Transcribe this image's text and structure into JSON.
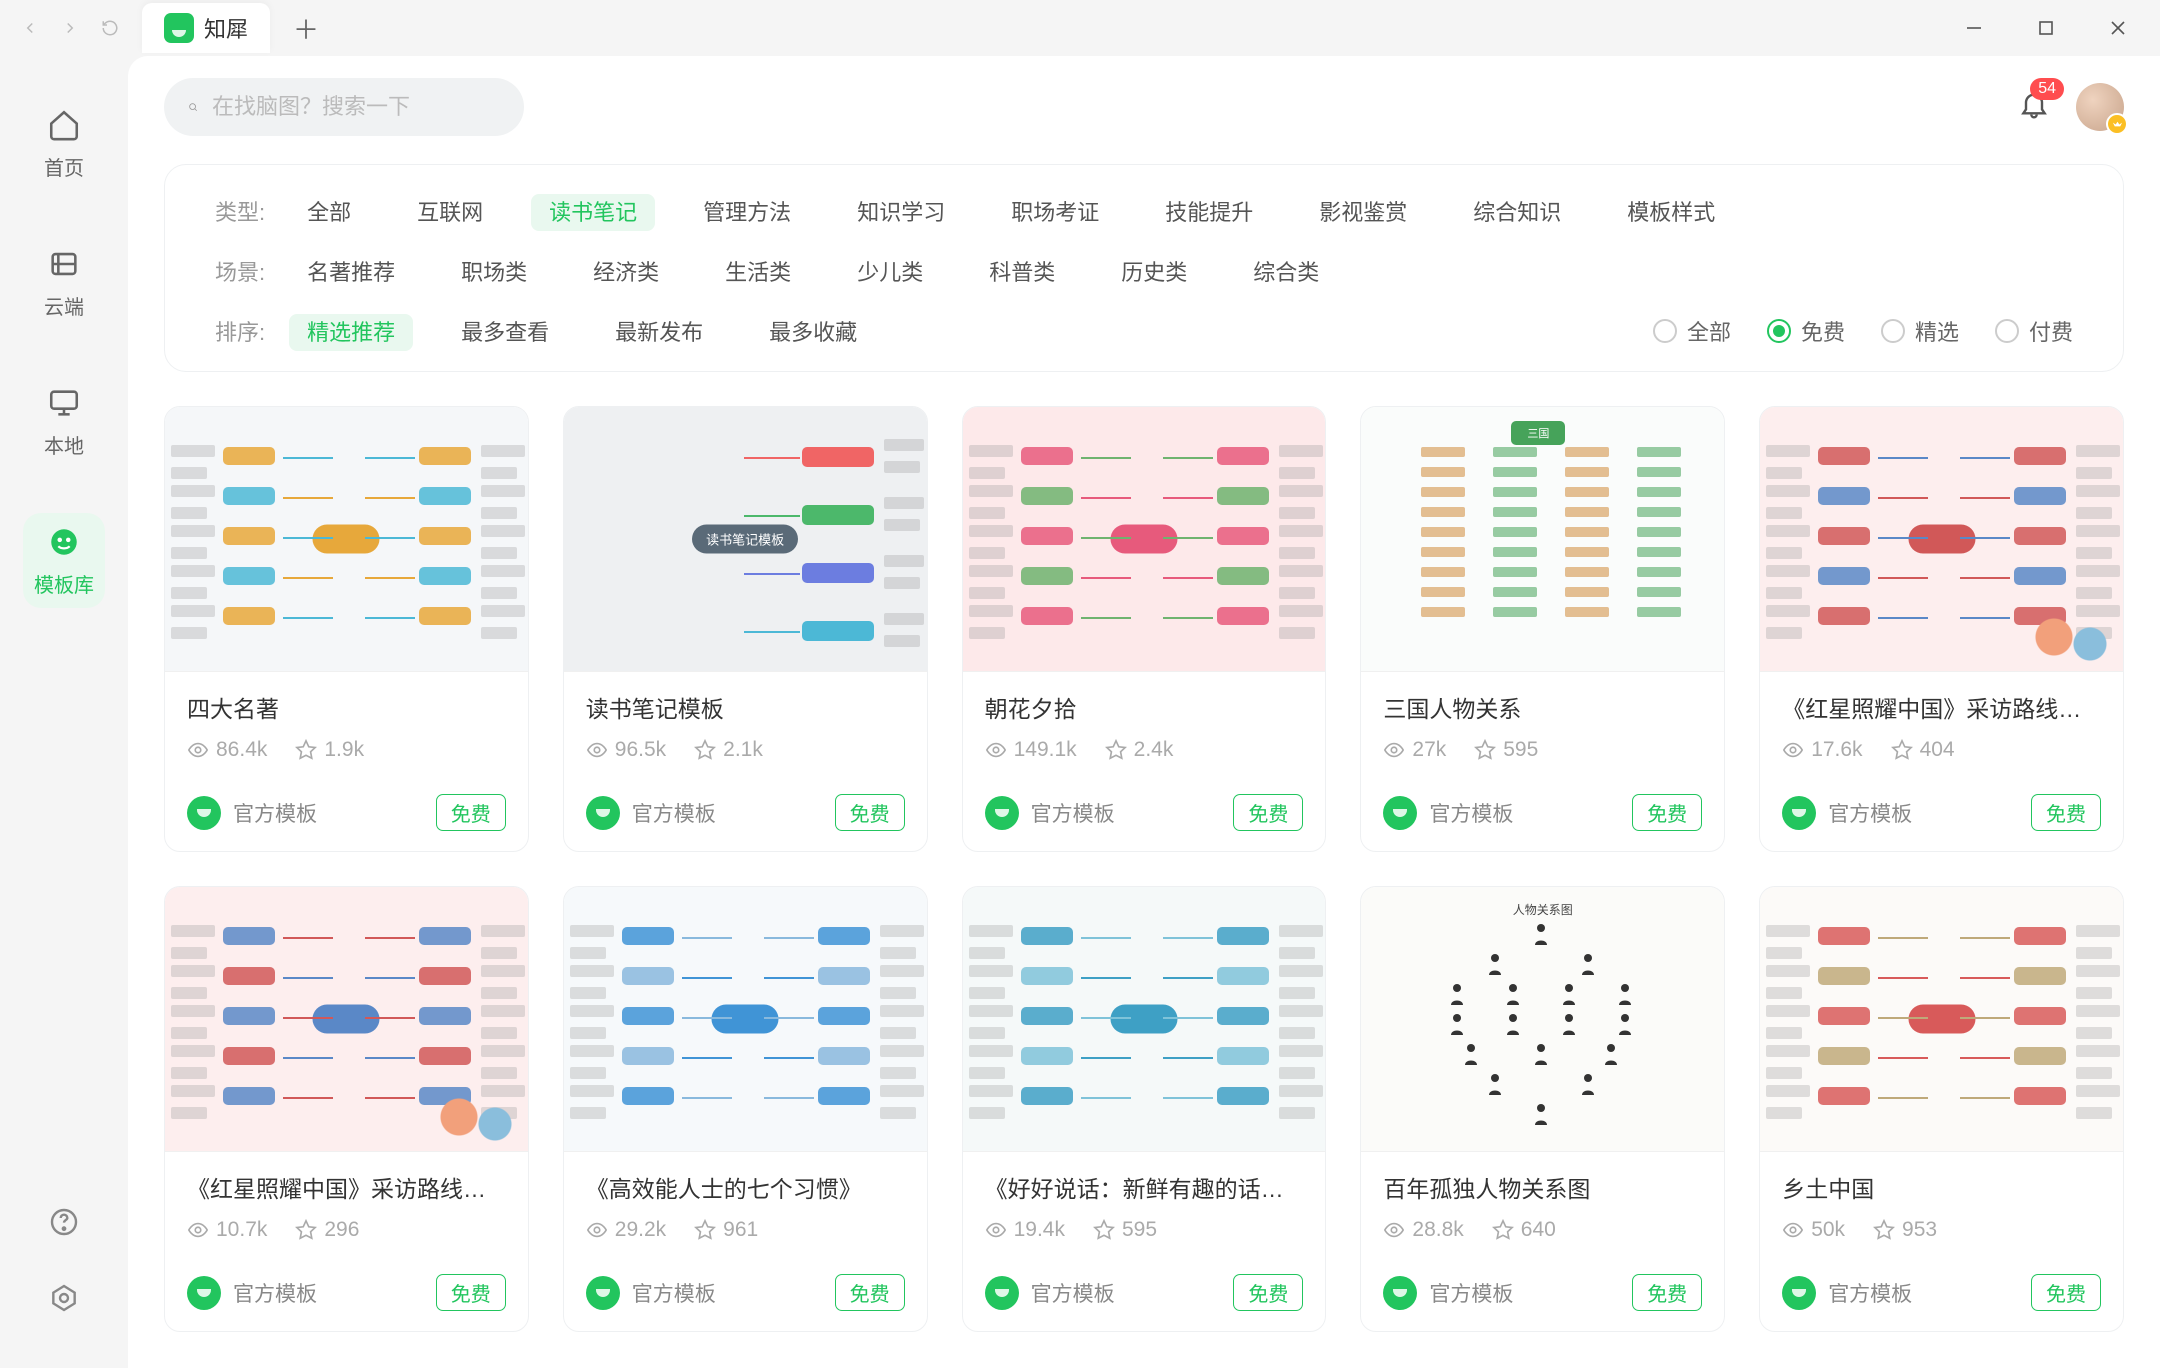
{
  "app": {
    "tab_title": "知犀"
  },
  "sidebar": {
    "items": [
      {
        "label": "首页"
      },
      {
        "label": "云端"
      },
      {
        "label": "本地"
      },
      {
        "label": "模板库"
      }
    ]
  },
  "search": {
    "placeholder": "在找脑图？搜索一下"
  },
  "notifications": {
    "count": "54"
  },
  "filters": {
    "type_label": "类型:",
    "types": [
      "全部",
      "互联网",
      "读书笔记",
      "管理方法",
      "知识学习",
      "职场考证",
      "技能提升",
      "影视鉴赏",
      "综合知识",
      "模板样式"
    ],
    "type_active_index": 2,
    "scene_label": "场景:",
    "scenes": [
      "名著推荐",
      "职场类",
      "经济类",
      "生活类",
      "少儿类",
      "科普类",
      "历史类",
      "综合类"
    ],
    "sort_label": "排序:",
    "sorts": [
      "精选推荐",
      "最多查看",
      "最新发布",
      "最多收藏"
    ],
    "sort_active_index": 0,
    "price": [
      "全部",
      "免费",
      "精选",
      "付费"
    ],
    "price_selected_index": 1
  },
  "source_label": "官方模板",
  "free_label": "免费",
  "cards": [
    {
      "title": "四大名著",
      "views": "86.4k",
      "stars": "1.9k",
      "bg": "#f5f7f9",
      "accent": "#e7a83b",
      "accent2": "#4cb8d6",
      "illust": false
    },
    {
      "title": "读书笔记模板",
      "views": "96.5k",
      "stars": "2.1k",
      "bg": "#eef0f2",
      "accent": "#f06565",
      "accent2": "#6c7de0",
      "illust": false
    },
    {
      "title": "朝花夕拾",
      "views": "149.1k",
      "stars": "2.4k",
      "bg": "#fde9ea",
      "accent": "#e75a7c",
      "accent2": "#6fb36f",
      "illust": false
    },
    {
      "title": "三国人物关系",
      "views": "27k",
      "stars": "595",
      "bg": "#fafcfb",
      "accent": "#46a35a",
      "accent2": "#d08a3a",
      "illust": false
    },
    {
      "title": "《红星照耀中国》采访路线及内...",
      "views": "17.6k",
      "stars": "404",
      "bg": "#fdeeee",
      "accent": "#d15858",
      "accent2": "#5a88c7",
      "illust": true
    },
    {
      "title": "《红星照耀中国》采访路线及内...",
      "views": "10.7k",
      "stars": "296",
      "bg": "#fdeeee",
      "accent": "#5a88c7",
      "accent2": "#d15858",
      "illust": true
    },
    {
      "title": "《高效能人士的七个习惯》",
      "views": "29.2k",
      "stars": "961",
      "bg": "#f6f9fb",
      "accent": "#4094d6",
      "accent2": "#89b9dd",
      "illust": false
    },
    {
      "title": "《好好说话：新鲜有趣的话术精...",
      "views": "19.4k",
      "stars": "595",
      "bg": "#f5f9f9",
      "accent": "#3ea0c5",
      "accent2": "#7fc3d9",
      "illust": false
    },
    {
      "title": "百年孤独人物关系图",
      "views": "28.8k",
      "stars": "640",
      "bg": "#fbfbf9",
      "accent": "#333",
      "accent2": "#888",
      "illust": false
    },
    {
      "title": "乡土中国",
      "views": "50k",
      "stars": "953",
      "bg": "#fcfaf8",
      "accent": "#d85a5a",
      "accent2": "#bfa97a",
      "illust": false
    }
  ]
}
